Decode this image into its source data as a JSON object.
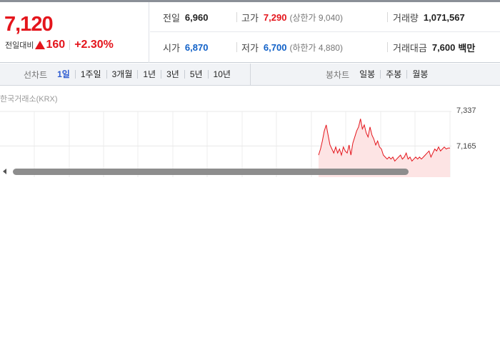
{
  "quote": {
    "current_price": "7,120",
    "change_label": "전일대비",
    "change_value": "160",
    "change_pct": "+2.30%",
    "prev_close": {
      "label": "전일",
      "value": "6,960"
    },
    "high": {
      "label": "고가",
      "value": "7,290",
      "limit_label": "(상한가 9,040)"
    },
    "volume": {
      "label": "거래량",
      "value": "1,071,567"
    },
    "open": {
      "label": "시가",
      "value": "6,870"
    },
    "low": {
      "label": "저가",
      "value": "6,700",
      "limit_label": "(하한가 4,880)"
    },
    "trade_amount": {
      "label": "거래대금",
      "value": "7,600",
      "unit": "백만"
    }
  },
  "line_tabs": {
    "title": "선차트",
    "items": [
      "1일",
      "1주일",
      "3개월",
      "1년",
      "3년",
      "5년",
      "10년"
    ],
    "active": "1일"
  },
  "candle_tabs": {
    "title": "봉차트",
    "items": [
      "일봉",
      "주봉",
      "월봉"
    ]
  },
  "chart": {
    "source": "한국거래소(KRX)",
    "y_ticks": [
      "7,337",
      "7,165"
    ]
  },
  "colors": {
    "up": "#e4151c",
    "down": "#1161c8",
    "active_tab": "#2d5bd1",
    "chart_line": "#e4151c",
    "chart_fill": "#fde4e4"
  },
  "chart_data": {
    "type": "area",
    "y_ticks": [
      7337,
      7165
    ],
    "ylim": [
      7010,
      7337
    ],
    "grid": true,
    "x": [
      0,
      1,
      2,
      3,
      4,
      5,
      6,
      7,
      8,
      9,
      10,
      11,
      12,
      13,
      14,
      15,
      16,
      17,
      18,
      19,
      20,
      21,
      22,
      23,
      24,
      25,
      26,
      27,
      28,
      29,
      30,
      31,
      32,
      33,
      34,
      35,
      36,
      37,
      38,
      39,
      40,
      41,
      42,
      43,
      44,
      45,
      46,
      47,
      48,
      49,
      50,
      51,
      52,
      53,
      54,
      55,
      56,
      57,
      58,
      59,
      60,
      61,
      62,
      63,
      64,
      65,
      66,
      67,
      68,
      69
    ],
    "series": [
      {
        "values": [
          7120,
          7150,
          7190,
          7240,
          7270,
          7220,
          7170,
          7150,
          7130,
          7160,
          7130,
          7150,
          7120,
          7160,
          7140,
          7130,
          7170,
          7120,
          7180,
          7210,
          7240,
          7260,
          7300,
          7250,
          7270,
          7230,
          7210,
          7260,
          7220,
          7200,
          7170,
          7190,
          7160,
          7150,
          7120,
          7110,
          7100,
          7110,
          7100,
          7110,
          7090,
          7100,
          7110,
          7120,
          7100,
          7110,
          7130,
          7100,
          7110,
          7090,
          7100,
          7110,
          7100,
          7110,
          7100,
          7110,
          7120,
          7130,
          7140,
          7110,
          7130,
          7150,
          7140,
          7160,
          7140,
          7150,
          7160,
          7150,
          7155,
          7155
        ]
      }
    ]
  }
}
